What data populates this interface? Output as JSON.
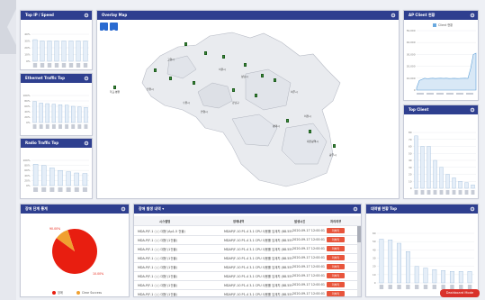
{
  "panels": {
    "top_ip": {
      "title": "Top IP / Speed"
    },
    "ethernet": {
      "title": "Ethernet Traffic Top"
    },
    "radio": {
      "title": "Radio Traffic Top"
    },
    "map": {
      "title": "Overlay Map"
    },
    "ap_client": {
      "title": "AP Client 현황",
      "legend": "Client 현황"
    },
    "top_client": {
      "title": "Top Client"
    },
    "alarm_stats": {
      "title": "장애 단계 통계"
    },
    "alarm_list": {
      "title": "장애 발생 내역 ▾"
    },
    "radio_status": {
      "title": "대역별 현황 Top"
    }
  },
  "pie": {
    "major_pct": "90.00%",
    "minor_pct": "10.00%",
    "legend": [
      "장애",
      "Clear Success"
    ],
    "colors": [
      "#e81e10",
      "#f0a030"
    ],
    "slices": [
      90,
      10
    ]
  },
  "alarm_table": {
    "headers": [
      "시스템명",
      "장애내역",
      "발생시간",
      "처리여부"
    ],
    "rows": [
      {
        "sys": "MDA-P/F-1 ○○ 대형 (Ap1-5 건물)",
        "msg": "MDAP/F-10 P1-4 3.1 CPU 사용률 임계치 (88.55%)",
        "time": "2020-09-17 12:00:01",
        "status": "미처리"
      },
      {
        "sys": "MDA-P/F-1 ○○ 대형 (1건물)",
        "msg": "MDAP/F-10 P1-4 3.1 CPU 사용률 임계치 (88.55%)",
        "time": "2020-09-17 12:00:01",
        "status": "미처리"
      },
      {
        "sys": "MDA-P/F-1 ○○ 대형 (1건물)",
        "msg": "MDAP/F-10 P1-4 3.1 CPU 사용률 임계치 (88.55%)",
        "time": "2020-09-17 12:00:01",
        "status": "미처리"
      },
      {
        "sys": "MDA-P/F-1 ○○ 대형 (1건물)",
        "msg": "MDAP/F-10 P1-4 3.1 CPU 사용률 임계치 (88.55%)",
        "time": "2020-09-17 12:00:01",
        "status": "미처리"
      },
      {
        "sys": "MDA-P/F-1 ○○ 대형 (1건물)",
        "msg": "MDAP/F-10 P1-4 3.1 CPU 사용률 임계치 (88.55%)",
        "time": "2020-09-17 12:00:01",
        "status": "미처리"
      },
      {
        "sys": "MDA-P/F-1 ○○ 대형 (1건물)",
        "msg": "MDAP/F-10 P1-4 3.1 CPU 사용률 임계치 (88.55%)",
        "time": "2020-09-17 12:00:01",
        "status": "미처리"
      },
      {
        "sys": "MDA-P/F-1 ○○ 대형 (1건물)",
        "msg": "MDAP/F-10 P1-4 3.1 CPU 사용률 임계치 (88.55%)",
        "time": "2020-09-17 12:00:01",
        "status": "미처리"
      },
      {
        "sys": "MDA-P/F-1 ○○ 대형 (1건물)",
        "msg": "MDAP/F-10 P1-4 3.1 CPU 사용률 임계치 (88.55%)",
        "time": "2020-09-17 12:00:01",
        "status": "미처리"
      }
    ]
  },
  "map_labels": [
    "학교·병원",
    "고양시",
    "서울시",
    "성남시",
    "수원시",
    "인천시",
    "강남구",
    "안양시",
    "평택시",
    "이천시",
    "여주시",
    "대전광역시",
    "광주시",
    "용인시",
    "시흥시",
    "화성시",
    "기타",
    "안산시",
    "부천시",
    "의정부시",
    "남양주시",
    "파주시",
    "하남시",
    "오산시",
    "군포시"
  ],
  "reserve_button": "Dashboard Mode",
  "chart_top_ip": {
    "type": "bar",
    "values": [
      32,
      30,
      30,
      30,
      30,
      30,
      30,
      30
    ],
    "ylim": [
      0,
      40
    ],
    "ticks": [
      "40%",
      "30%",
      "20%",
      "10%",
      "0%"
    ]
  },
  "chart_ethernet": {
    "type": "bar",
    "values": [
      78,
      72,
      70,
      68,
      66,
      64,
      60,
      58,
      56
    ],
    "ylim": [
      0,
      100
    ],
    "ticks": [
      "100%",
      "80%",
      "60%",
      "40%",
      "20%",
      "0%"
    ]
  },
  "chart_radio": {
    "type": "bar",
    "values": [
      85,
      80,
      70,
      60,
      55,
      50,
      48
    ],
    "ylim": [
      0,
      100
    ],
    "ticks": [
      "100%",
      "80%",
      "60%",
      "40%",
      "20%",
      "0%"
    ]
  },
  "chart_ap": {
    "type": "area",
    "ylim": [
      0,
      50000
    ],
    "ticks": [
      "50,000",
      "40,000",
      "30,000",
      "20,000",
      "10,000",
      "0"
    ],
    "values": [
      2000,
      8000,
      9000,
      10000,
      9500,
      9800,
      10000,
      9700,
      9900,
      10000,
      9800,
      10000,
      9700,
      9800,
      9900,
      9700,
      9800,
      9900,
      10000,
      9800,
      18000,
      30000,
      31000
    ]
  },
  "chart_top_client": {
    "type": "bar",
    "values": [
      75,
      60,
      60,
      40,
      30,
      20,
      15,
      10,
      8,
      5
    ],
    "ylim": [
      0,
      80
    ],
    "ticks": [
      "80",
      "70",
      "60",
      "50",
      "40",
      "30",
      "20",
      "10",
      "0"
    ]
  },
  "chart_radio_status": {
    "type": "bar",
    "values": [
      53,
      52,
      48,
      38,
      20,
      18,
      16,
      15,
      14,
      14,
      14
    ],
    "ylim": [
      0,
      60
    ],
    "ticks": [
      "60",
      "50",
      "40",
      "30",
      "20",
      "10",
      "0"
    ]
  }
}
